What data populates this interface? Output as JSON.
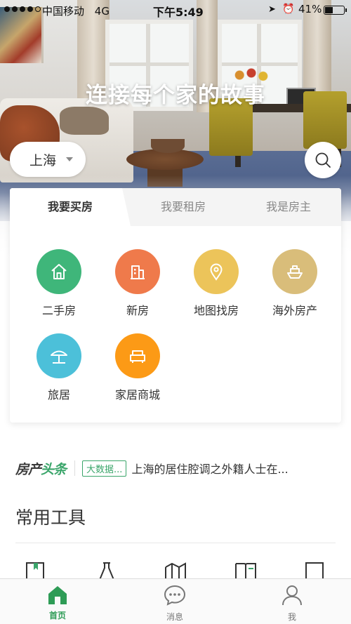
{
  "status_bar": {
    "carrier": "中国移动",
    "network": "4G",
    "time": "下午5:49",
    "battery_percent": "41%",
    "battery_level": 0.41,
    "signal_bars_filled": 4,
    "signal_bars_total": 5
  },
  "hero": {
    "slogan": "连接每个家的故事",
    "city": "上海",
    "search_icon": "search-icon"
  },
  "card": {
    "tabs": [
      {
        "label": "我要买房",
        "active": true
      },
      {
        "label": "我要租房",
        "active": false
      },
      {
        "label": "我是房主",
        "active": false
      }
    ],
    "entries": [
      {
        "label": "二手房",
        "icon": "house-icon",
        "color": "#3fb67a"
      },
      {
        "label": "新房",
        "icon": "building-icon",
        "color": "#ef7a4b"
      },
      {
        "label": "地图找房",
        "icon": "map-pin-icon",
        "color": "#ecc45a"
      },
      {
        "label": "海外房产",
        "icon": "ship-icon",
        "color": "#d9bd7a"
      },
      {
        "label": "旅居",
        "icon": "beach-umbrella-icon",
        "color": "#4cc0d9"
      },
      {
        "label": "家居商城",
        "icon": "sofa-icon",
        "color": "#fc9a16"
      }
    ]
  },
  "news": {
    "brand_part1": "房产",
    "brand_part2": "头条",
    "tag": "大数据...",
    "headline": "上海的居住腔调之外籍人士在..."
  },
  "tools": {
    "title": "常用工具"
  },
  "bottom_nav": {
    "items": [
      {
        "label": "首页",
        "icon": "home-icon",
        "active": true
      },
      {
        "label": "消息",
        "icon": "chat-icon",
        "active": false
      },
      {
        "label": "我",
        "icon": "user-icon",
        "active": false
      }
    ]
  },
  "colors": {
    "accent_green": "#2e9c56"
  }
}
